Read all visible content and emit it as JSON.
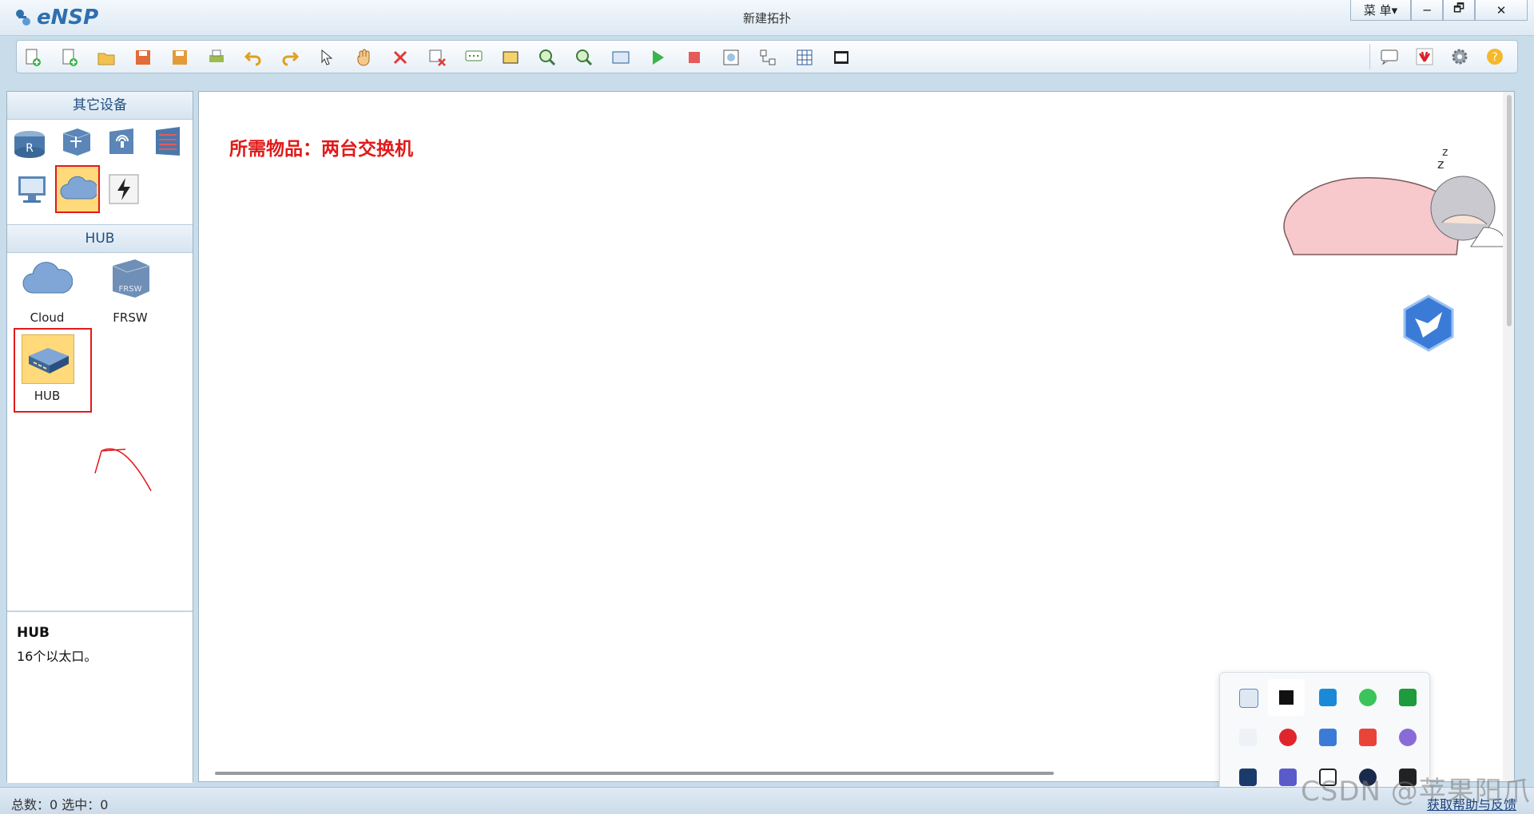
{
  "app": {
    "logo_text": "eNSP",
    "window_title": "新建拓扑"
  },
  "window_controls": {
    "menu_label": "菜 单▾",
    "minimize": "─",
    "restore": "🗗",
    "close": "✕"
  },
  "toolbar": {
    "icons": [
      "new-topology-icon",
      "new-lab-icon",
      "open-icon",
      "save-icon",
      "save-as-icon",
      "print-icon",
      "undo-icon",
      "redo-icon",
      "select-pointer-icon",
      "hand-move-icon",
      "delete-icon",
      "delete-link-icon",
      "text-note-icon",
      "rectangle-icon",
      "zoom-in-icon",
      "zoom-out-icon",
      "fit-view-icon",
      "start-device-icon",
      "stop-device-icon",
      "capture-icon",
      "topology-icon",
      "grid-icon",
      "screenshot-icon"
    ],
    "right_icons": [
      "chat-icon",
      "huawei-icon",
      "settings-icon",
      "help-icon"
    ]
  },
  "left_panel": {
    "section1_title": "其它设备",
    "section2_title": "HUB",
    "devices": [
      {
        "label": "Cloud"
      },
      {
        "label": "FRSW"
      },
      {
        "label": "HUB"
      }
    ],
    "description": {
      "title": "HUB",
      "text": "16个以太口。"
    }
  },
  "canvas": {
    "note": "所需物品：两台交换机"
  },
  "status": {
    "left": "总数：0  选中：0",
    "help": "获取帮助与反馈"
  },
  "watermark": "CSDN @苹果阳爪",
  "colors": {
    "annotation_red": "#e11a1a",
    "highlight": "#ffd97a",
    "accent_blue": "#2e6fb0"
  }
}
